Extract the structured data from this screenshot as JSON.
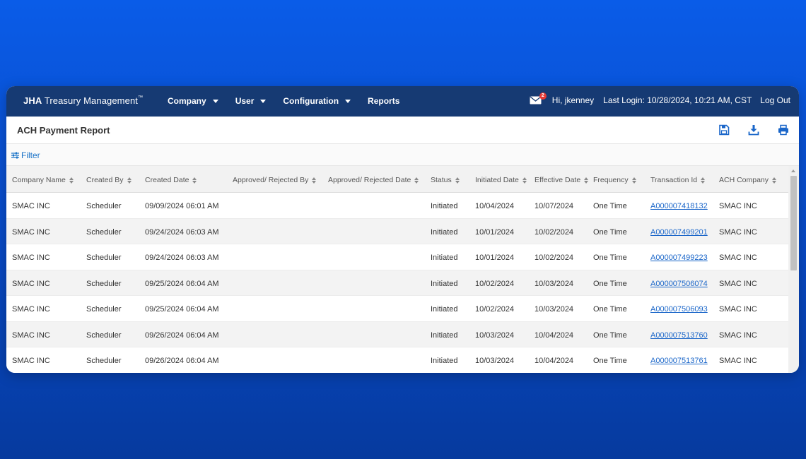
{
  "app": {
    "brand_bold": "JHA",
    "brand_rest": " Treasury Management",
    "brand_tm": "™"
  },
  "nav": {
    "items": [
      {
        "label": "Company",
        "dropdown": true
      },
      {
        "label": "User",
        "dropdown": true
      },
      {
        "label": "Configuration",
        "dropdown": true
      },
      {
        "label": "Reports",
        "dropdown": false
      }
    ],
    "mail_icon": "mail-icon",
    "mail_badge": "2",
    "greeting": "Hi, jkenney",
    "last_login": "Last Login: 10/28/2024, 10:21 AM, CST",
    "logout": "Log Out"
  },
  "page": {
    "title": "ACH Payment Report",
    "actions": [
      "save-icon",
      "download-icon",
      "print-icon"
    ],
    "filter_label": "Filter"
  },
  "colors": {
    "nav_bg": "#163a73",
    "link": "#1a66c9",
    "background": "#0a5ce8"
  },
  "table": {
    "columns": [
      "Company Name",
      "Created By",
      "Created Date",
      "Approved/ Rejected By",
      "Approved/ Rejected Date",
      "Status",
      "Initiated Date",
      "Effective Date",
      "Frequency",
      "Transaction Id",
      "ACH Company"
    ],
    "rows": [
      {
        "company": "SMAC INC",
        "created_by": "Scheduler",
        "created_date": "09/09/2024 06:01 AM",
        "approved_by": "",
        "approved_date": "",
        "status": "Initiated",
        "initiated": "10/04/2024",
        "effective": "10/07/2024",
        "frequency": "One Time",
        "txn": "A000007418132",
        "ach_company": "SMAC INC"
      },
      {
        "company": "SMAC INC",
        "created_by": "Scheduler",
        "created_date": "09/24/2024 06:03 AM",
        "approved_by": "",
        "approved_date": "",
        "status": "Initiated",
        "initiated": "10/01/2024",
        "effective": "10/02/2024",
        "frequency": "One Time",
        "txn": "A000007499201",
        "ach_company": "SMAC INC"
      },
      {
        "company": "SMAC INC",
        "created_by": "Scheduler",
        "created_date": "09/24/2024 06:03 AM",
        "approved_by": "",
        "approved_date": "",
        "status": "Initiated",
        "initiated": "10/01/2024",
        "effective": "10/02/2024",
        "frequency": "One Time",
        "txn": "A000007499223",
        "ach_company": "SMAC INC"
      },
      {
        "company": "SMAC INC",
        "created_by": "Scheduler",
        "created_date": "09/25/2024 06:04 AM",
        "approved_by": "",
        "approved_date": "",
        "status": "Initiated",
        "initiated": "10/02/2024",
        "effective": "10/03/2024",
        "frequency": "One Time",
        "txn": "A000007506074",
        "ach_company": "SMAC INC"
      },
      {
        "company": "SMAC INC",
        "created_by": "Scheduler",
        "created_date": "09/25/2024 06:04 AM",
        "approved_by": "",
        "approved_date": "",
        "status": "Initiated",
        "initiated": "10/02/2024",
        "effective": "10/03/2024",
        "frequency": "One Time",
        "txn": "A000007506093",
        "ach_company": "SMAC INC"
      },
      {
        "company": "SMAC INC",
        "created_by": "Scheduler",
        "created_date": "09/26/2024 06:04 AM",
        "approved_by": "",
        "approved_date": "",
        "status": "Initiated",
        "initiated": "10/03/2024",
        "effective": "10/04/2024",
        "frequency": "One Time",
        "txn": "A000007513760",
        "ach_company": "SMAC INC"
      },
      {
        "company": "SMAC INC",
        "created_by": "Scheduler",
        "created_date": "09/26/2024 06:04 AM",
        "approved_by": "",
        "approved_date": "",
        "status": "Initiated",
        "initiated": "10/03/2024",
        "effective": "10/04/2024",
        "frequency": "One Time",
        "txn": "A000007513761",
        "ach_company": "SMAC INC"
      }
    ]
  }
}
